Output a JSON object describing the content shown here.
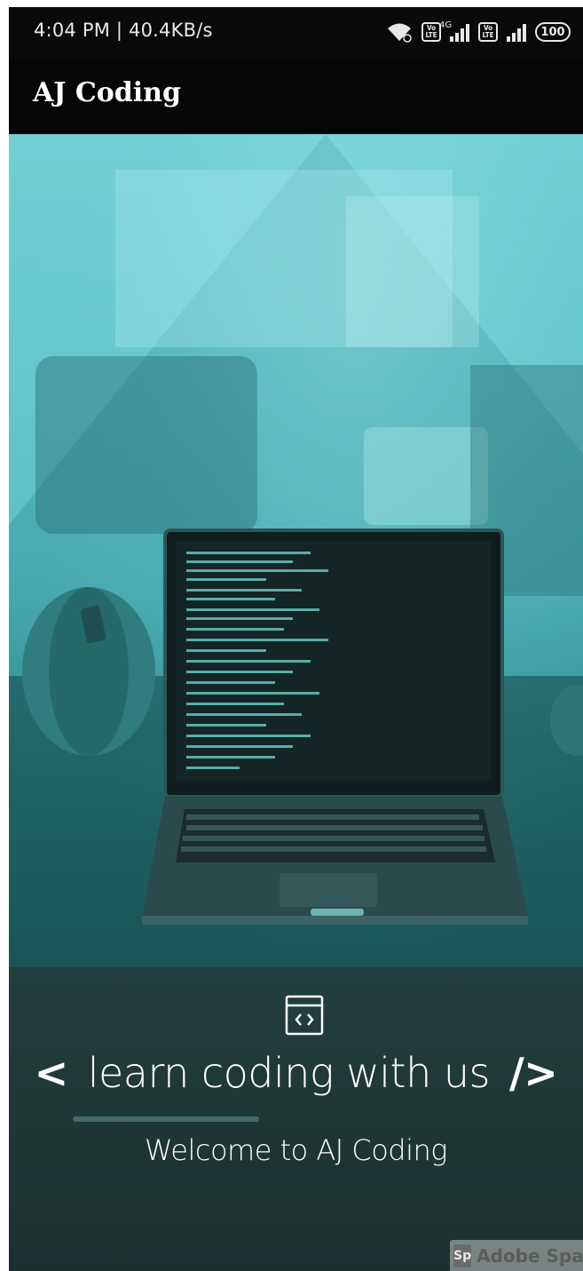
{
  "status_bar": {
    "time_speed": "4:04 PM | 40.4KB/s",
    "volte_label": "Vo LTE",
    "network_label": "4G",
    "battery": "100"
  },
  "app_bar": {
    "title": "AJ Coding"
  },
  "hero": {
    "image_description": "laptop-on-table-teal-photo",
    "accent_color": "#5cc2c8"
  },
  "intro": {
    "icon": "code-window-icon",
    "open_bracket": "<",
    "tagline": "learn coding with us",
    "close_bracket": "/>",
    "welcome": "Welcome to AJ Coding"
  },
  "watermark": {
    "logo": "Sp",
    "text": "Adobe Spark"
  }
}
